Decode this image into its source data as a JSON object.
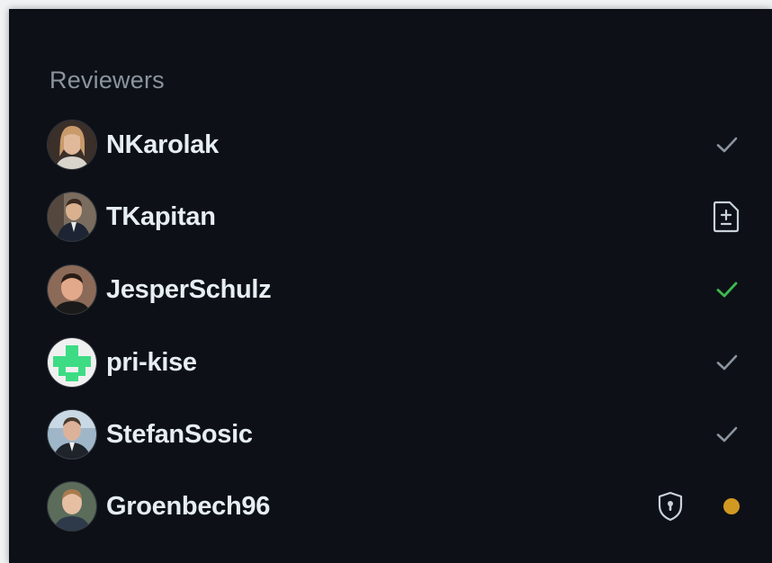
{
  "reviewers": {
    "heading": "Reviewers",
    "items": [
      {
        "name": "NKarolak",
        "status": "approved-gray"
      },
      {
        "name": "TKapitan",
        "status": "file-diff"
      },
      {
        "name": "JesperSchulz",
        "status": "approved-green"
      },
      {
        "name": "pri-kise",
        "status": "approved-gray"
      },
      {
        "name": "StefanSosic",
        "status": "approved-gray"
      },
      {
        "name": "Groenbech96",
        "status": "pending",
        "extra_icon": "shield-lock"
      }
    ]
  },
  "colors": {
    "background": "#0d1117",
    "heading": "#8b949e",
    "name": "#e6edf3",
    "check_gray": "#8b949e",
    "check_green": "#3fb950",
    "pending_dot": "#d29922",
    "identicon_green": "#3ddc84"
  }
}
